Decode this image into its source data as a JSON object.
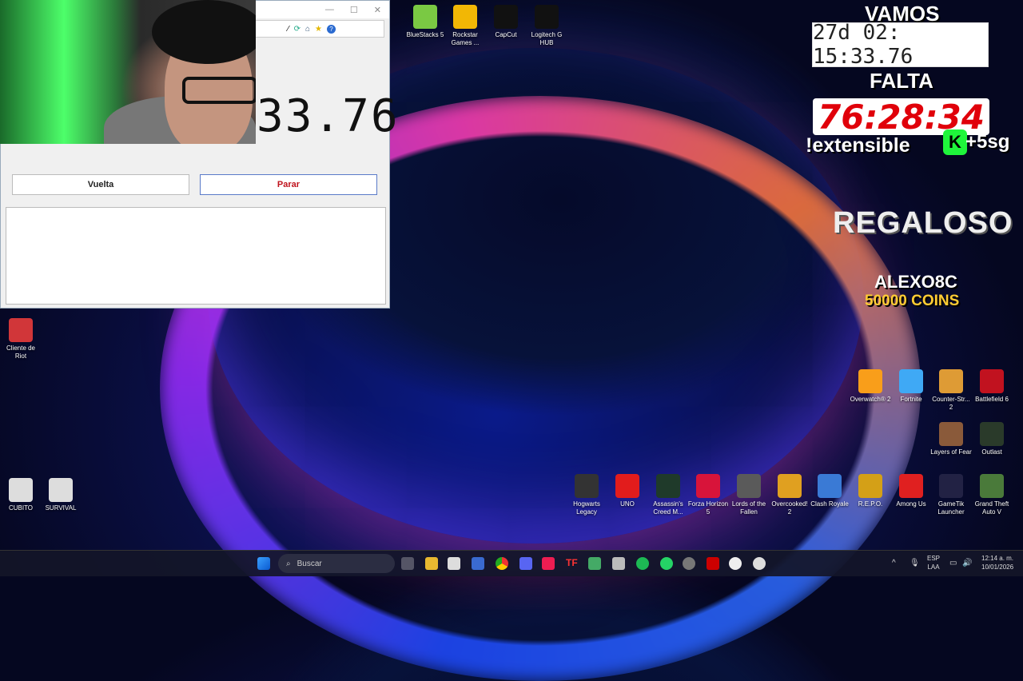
{
  "stopwatch": {
    "display_partial": "33.76",
    "lap_button": "Vuelta",
    "stop_button": "Parar",
    "stop_color": "#c0141e"
  },
  "overlay": {
    "vamos": "VAMOS",
    "elapsed": "27d 02: 15:33.76",
    "falta": "FALTA",
    "countdown": "76:28:34",
    "extensible": "!extensible",
    "k_badge": "K",
    "plus_time": "+5sg",
    "regaloso": "REGALOSO",
    "donor": "ALEXO8C",
    "coins": "50000 COINS"
  },
  "desktop_top": [
    {
      "label": "BlueStacks 5",
      "icon": "bluestacks-icon",
      "color": "#7ac943"
    },
    {
      "label": "Rockstar Games ...",
      "icon": "rockstar-icon",
      "color": "#f2b705"
    },
    {
      "label": "CapCut",
      "icon": "capcut-icon",
      "color": "#111111"
    },
    {
      "label": "Logitech G HUB",
      "icon": "logitech-icon",
      "color": "#111111"
    }
  ],
  "desktop_left": [
    {
      "label": "Cliente de Riot",
      "icon": "riot-icon",
      "color": "#d13639"
    },
    {
      "label": "CUBITO",
      "icon": "settings-icon",
      "color": "#dddddd"
    },
    {
      "label": "SURVIVAL",
      "icon": "settings-icon",
      "color": "#dddddd"
    }
  ],
  "desktop_right": [
    {
      "label": "Overwatch® 2",
      "icon": "overwatch-icon",
      "color": "#f99e1a"
    },
    {
      "label": "Fortnite",
      "icon": "fortnite-icon",
      "color": "#3fa9f5"
    },
    {
      "label": "Counter-Str... 2",
      "icon": "counterstrike-icon",
      "color": "#de9b35"
    },
    {
      "label": "Battlefield 6",
      "icon": "battlefield-icon",
      "color": "#c1121f"
    },
    {
      "label": "Layers of Fear",
      "icon": "layers-of-fear-icon",
      "color": "#8a5a3a"
    },
    {
      "label": "Outlast",
      "icon": "outlast-icon",
      "color": "#2a3a2a"
    }
  ],
  "desktop_bottom": [
    {
      "label": "Hogwarts Legacy",
      "icon": "hogwarts-icon",
      "color": "#333333"
    },
    {
      "label": "UNO",
      "icon": "uno-icon",
      "color": "#e21c1c"
    },
    {
      "label": "Assassin's Creed M...",
      "icon": "assassins-creed-icon",
      "color": "#1f3a2a"
    },
    {
      "label": "Forza Horizon 5",
      "icon": "forza-icon",
      "color": "#d8143a"
    },
    {
      "label": "Lords of the Fallen",
      "icon": "lords-fallen-icon",
      "color": "#5a5a5a"
    },
    {
      "label": "Overcooked! 2",
      "icon": "overcooked-icon",
      "color": "#e0a020"
    },
    {
      "label": "Clash Royale",
      "icon": "clash-royale-icon",
      "color": "#3a7ad5"
    },
    {
      "label": "R.E.P.O.",
      "icon": "repo-icon",
      "color": "#d4a017"
    },
    {
      "label": "Among Us",
      "icon": "among-us-icon",
      "color": "#e02020"
    },
    {
      "label": "GameTik Launcher",
      "icon": "gametik-icon",
      "color": "#222244"
    },
    {
      "label": "Grand Theft Auto V",
      "icon": "gta-icon",
      "color": "#4a7a3a"
    }
  ],
  "taskbar": {
    "search_placeholder": "Buscar",
    "lang_top": "ESP",
    "lang_bottom": "LAA",
    "time": "12:14 a. m.",
    "date": "10/01/2026"
  }
}
